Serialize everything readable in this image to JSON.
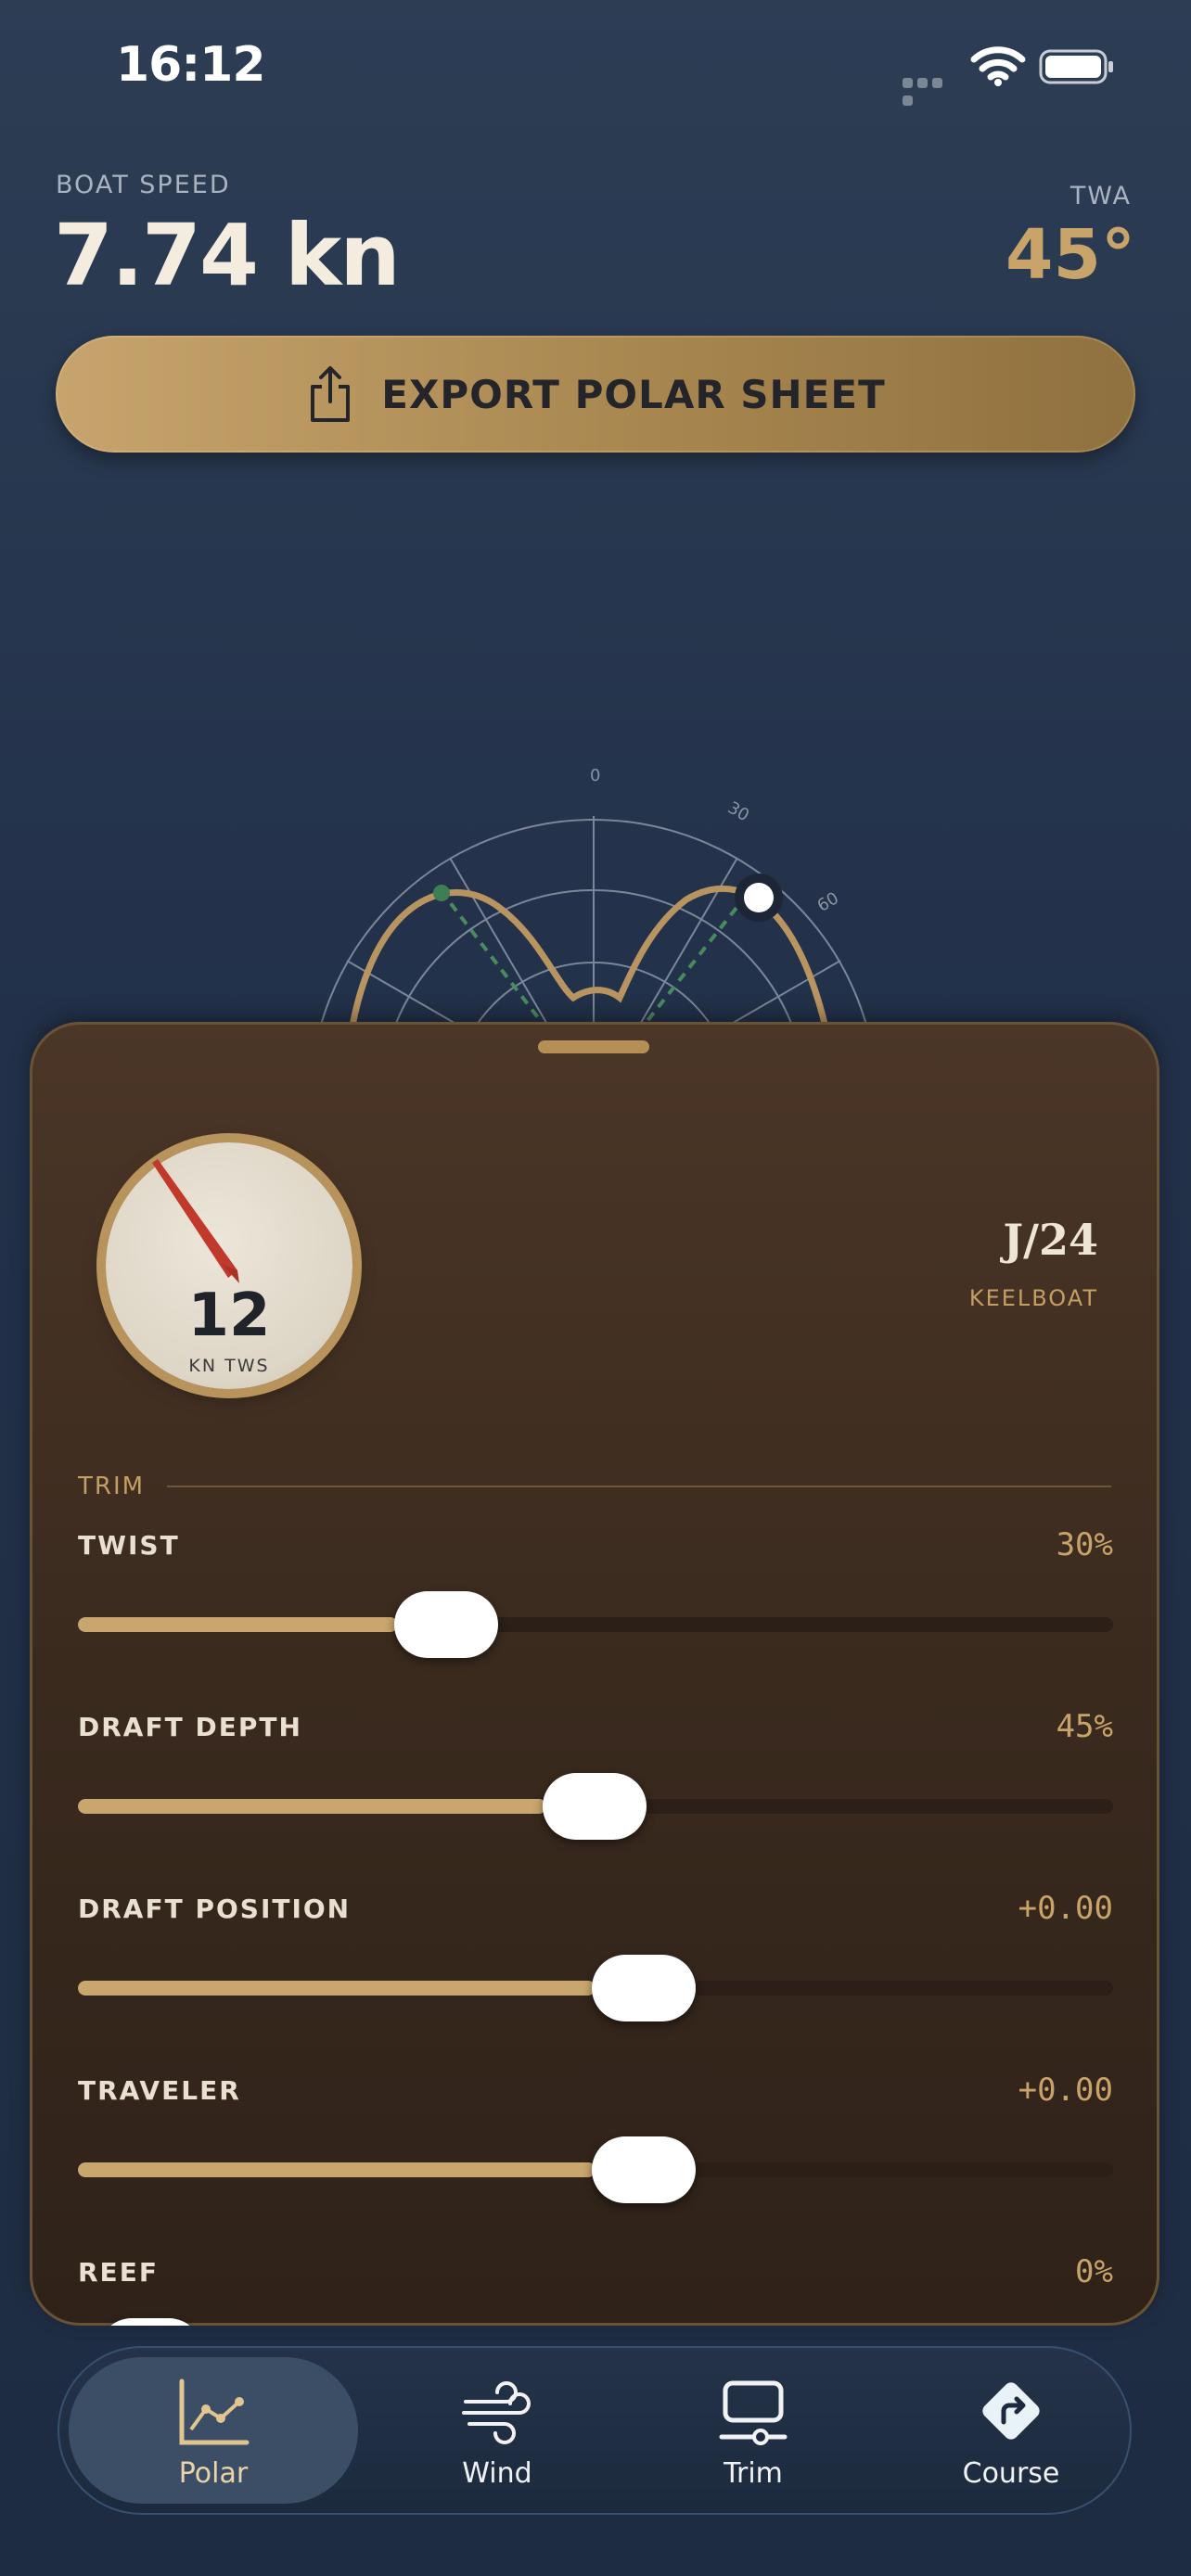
{
  "status_bar": {
    "time": "16:12"
  },
  "header": {
    "speed_label": "BOAT SPEED",
    "speed_value": "7.74 kn",
    "twa_label": "TWA",
    "twa_value": "45°"
  },
  "export_button": {
    "label": "EXPORT POLAR SHEET",
    "icon": "share-icon"
  },
  "boat": {
    "name": "J/24",
    "class": "KEELBOAT"
  },
  "wind_dial": {
    "value": "12",
    "unit": "KN TWS"
  },
  "trim": {
    "header": "TRIM",
    "sliders": [
      {
        "name": "TWIST",
        "value_text": "30%",
        "level": 0.3
      },
      {
        "name": "DRAFT DEPTH",
        "value_text": "45%",
        "level": 0.45
      },
      {
        "name": "DRAFT POSITION",
        "value_text": "+0.00",
        "level": 0.5
      },
      {
        "name": "TRAVELER",
        "value_text": "+0.00",
        "level": 0.5
      },
      {
        "name": "REEF",
        "value_text": "0%",
        "level": 0.0
      }
    ]
  },
  "tabs": [
    {
      "label": "Polar",
      "icon": "chart-icon",
      "active": true
    },
    {
      "label": "Wind",
      "icon": "wind-icon",
      "active": false
    },
    {
      "label": "Trim",
      "icon": "trim-icon",
      "active": false
    },
    {
      "label": "Course",
      "icon": "course-icon",
      "active": false
    }
  ],
  "colors": {
    "accent": "#c9a46a",
    "panel": "#3a2a1e",
    "background": "#223149"
  }
}
